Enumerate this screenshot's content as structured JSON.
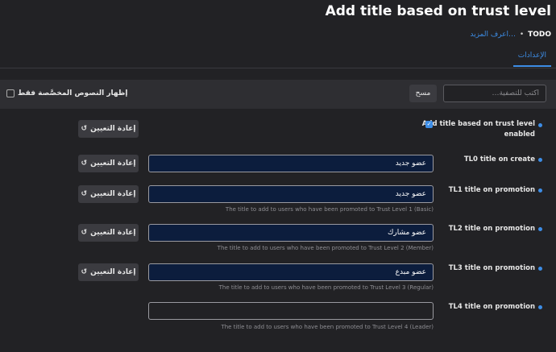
{
  "header": {
    "title": "Add title based on trust level",
    "todo": "TODO",
    "learn_more": "اعرف المزيد…"
  },
  "tabs": [
    {
      "label": "الإعدادات",
      "active": true
    }
  ],
  "filter": {
    "placeholder": "اكتب للتصفية…",
    "clear_label": "مسح",
    "custom_only_label": "إظهار النصوص المخصَّصة فقط",
    "custom_only_checked": false
  },
  "reset_label": "إعادة التعيين",
  "settings": [
    {
      "label": "Add title based on trust level enabled",
      "type": "checkbox",
      "checked": true
    },
    {
      "label": "TL0 title on create",
      "value": "عضو جديد",
      "description": ""
    },
    {
      "label": "TL1 title on promotion",
      "value": "عضو جديد",
      "description": "The title to add to users who have been promoted to Trust Level 1 (Basic)"
    },
    {
      "label": "TL2 title on promotion",
      "value": "عضو مشارك",
      "description": "The title to add to users who have been promoted to Trust Level 2 (Member)"
    },
    {
      "label": "TL3 title on promotion",
      "value": "عضو مبدع",
      "description": "The title to add to users who have been promoted to Trust Level 3 (Regular)"
    },
    {
      "label": "TL4 title on promotion",
      "value": "",
      "description": "The title to add to users who have been promoted to Trust Level 4 (Leader)"
    }
  ],
  "colors": {
    "accent": "#3d8de6",
    "background": "#222225",
    "input_filled": "#0c1d3d"
  }
}
